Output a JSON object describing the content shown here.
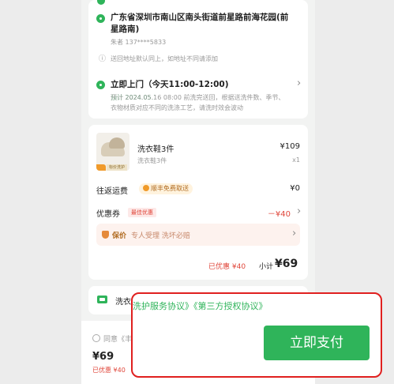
{
  "address": {
    "line1": "广东省深圳市南山区南头街道前星路前海花园(前",
    "line2": "星路南)",
    "contact": "朱者 137****5833",
    "notice": "送回地址默认同上，如地址不同请添加"
  },
  "pickup": {
    "title": "立即上门（今天11:00-12:00)",
    "estimate_line1": "预计 2024.05.16 08:00 前洗完送回，根据送洗件数、季节、",
    "estimate_line2": "衣物材质对应不同的洗涤工艺，请洗时效会波动"
  },
  "goods": {
    "name": "洗衣鞋3件",
    "price": "¥109",
    "sub": "洗衣鞋3件",
    "qty": "x1",
    "thumb_tag": "标价洗护"
  },
  "shipping": {
    "label": "往返运费",
    "pill": "顺丰免费取送",
    "value": "¥0"
  },
  "coupon": {
    "label": "优惠券",
    "badge": "最佳优惠",
    "value": "－¥40"
  },
  "protect": {
    "label": "保价",
    "desc": "专人受理 洗坏必赔"
  },
  "summary": {
    "discount": "已优惠 ¥40",
    "subtotal_label": "小计",
    "subtotal_value": "¥69"
  },
  "clean_row": {
    "label": "洗衣"
  },
  "bottom": {
    "agree_prefix": "同意《丰",
    "price": "¥69",
    "discount": "已优惠 ¥40"
  },
  "overlay": {
    "agreements": "洗护服务协议》《第三方授权协议》",
    "pay_button": "立即支付"
  },
  "colors": {
    "brand_green": "#2fb45a",
    "accent_red": "#e0201f",
    "discount_red": "#e0463a"
  }
}
